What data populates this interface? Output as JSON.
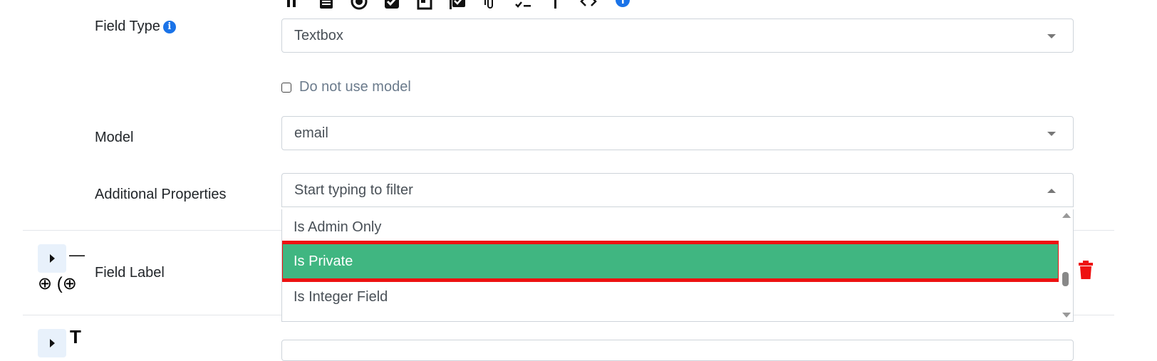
{
  "toolbar": {
    "icons": [
      "text-format-icon",
      "document-icon",
      "radio-icon",
      "checkbox-icon",
      "layout-icon",
      "multi-check-icon",
      "attachment-icon",
      "checklist-icon",
      "text-cursor-icon",
      "code-icon",
      "info-icon"
    ]
  },
  "field_type": {
    "label": "Field Type",
    "value": "Textbox"
  },
  "do_not_use_model": {
    "label": "Do not use model",
    "checked": false
  },
  "model": {
    "label": "Model",
    "value": "email"
  },
  "additional_properties": {
    "label": "Additional Properties",
    "placeholder": "Start typing to filter",
    "options": [
      {
        "label": "Is Admin Only",
        "selected": false
      },
      {
        "label": "Is Private",
        "selected": true
      },
      {
        "label": "Is Integer Field",
        "selected": false
      }
    ]
  },
  "row2": {
    "label": "Field Label",
    "dash_glyph": "—",
    "add_glyphs": "⊕ (⊕"
  },
  "row3": {
    "type_glyph": "T"
  },
  "colors": {
    "selected_bg": "#40b681",
    "highlight_border": "#ee1111",
    "info_blue": "#1a73e8",
    "delete_red": "#ee1111"
  }
}
